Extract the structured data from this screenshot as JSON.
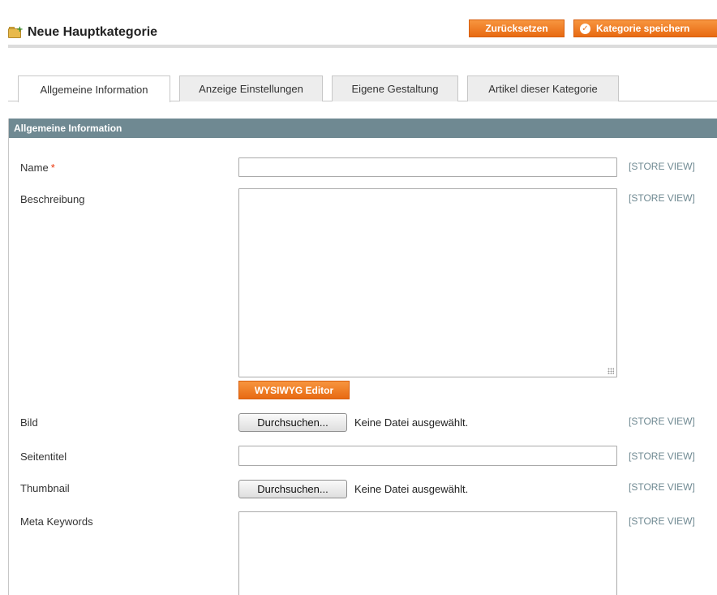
{
  "header": {
    "title": "Neue Hauptkategorie",
    "reset_label": "Zurücksetzen",
    "save_label": "Kategorie speichern"
  },
  "tabs": [
    {
      "label": "Allgemeine Information",
      "active": true
    },
    {
      "label": "Anzeige Einstellungen",
      "active": false
    },
    {
      "label": "Eigene Gestaltung",
      "active": false
    },
    {
      "label": "Artikel dieser Kategorie",
      "active": false
    }
  ],
  "section": {
    "title": "Allgemeine Information"
  },
  "form": {
    "scope_label": "[STORE VIEW]",
    "name": {
      "label": "Name",
      "required_mark": "*",
      "value": ""
    },
    "description": {
      "label": "Beschreibung",
      "value": "",
      "wysiwyg_label": "WYSIWYG Editor"
    },
    "image": {
      "label": "Bild",
      "browse_label": "Durchsuchen...",
      "status": "Keine Datei ausgewählt."
    },
    "page_title": {
      "label": "Seitentitel",
      "value": ""
    },
    "thumbnail": {
      "label": "Thumbnail",
      "browse_label": "Durchsuchen...",
      "status": "Keine Datei ausgewählt."
    },
    "meta_keywords": {
      "label": "Meta Keywords",
      "value": ""
    }
  },
  "colors": {
    "accent_orange": "#eb6f16",
    "section_header": "#6f8992",
    "required": "#eb340a"
  },
  "icons": {
    "header": "folder-add-icon",
    "save": "checkmark-circle-icon"
  }
}
